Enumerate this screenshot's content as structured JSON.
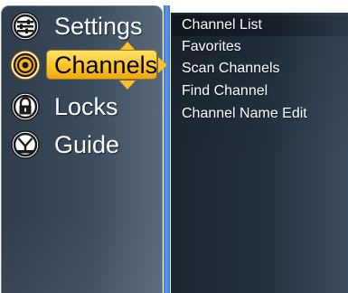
{
  "colors": {
    "accent_yellow": "#fbc52a",
    "blue_divider": "#4a86e0",
    "text_white": "#ffffff"
  },
  "main_menu": {
    "items": [
      {
        "label": "Settings",
        "icon": "settings-sliders-icon",
        "selected": false
      },
      {
        "label": "Channels",
        "icon": "antenna-broadcast-icon",
        "selected": true
      },
      {
        "label": "Locks",
        "icon": "lock-icon",
        "selected": false
      },
      {
        "label": "Guide",
        "icon": "guide-dish-icon",
        "selected": false
      }
    ]
  },
  "submenu": {
    "items": [
      {
        "label": "Channel List",
        "highlighted": true
      },
      {
        "label": "Favorites",
        "highlighted": false
      },
      {
        "label": "Scan Channels",
        "highlighted": false
      },
      {
        "label": "Find Channel",
        "highlighted": false
      },
      {
        "label": "Channel Name Edit",
        "highlighted": false
      }
    ]
  }
}
